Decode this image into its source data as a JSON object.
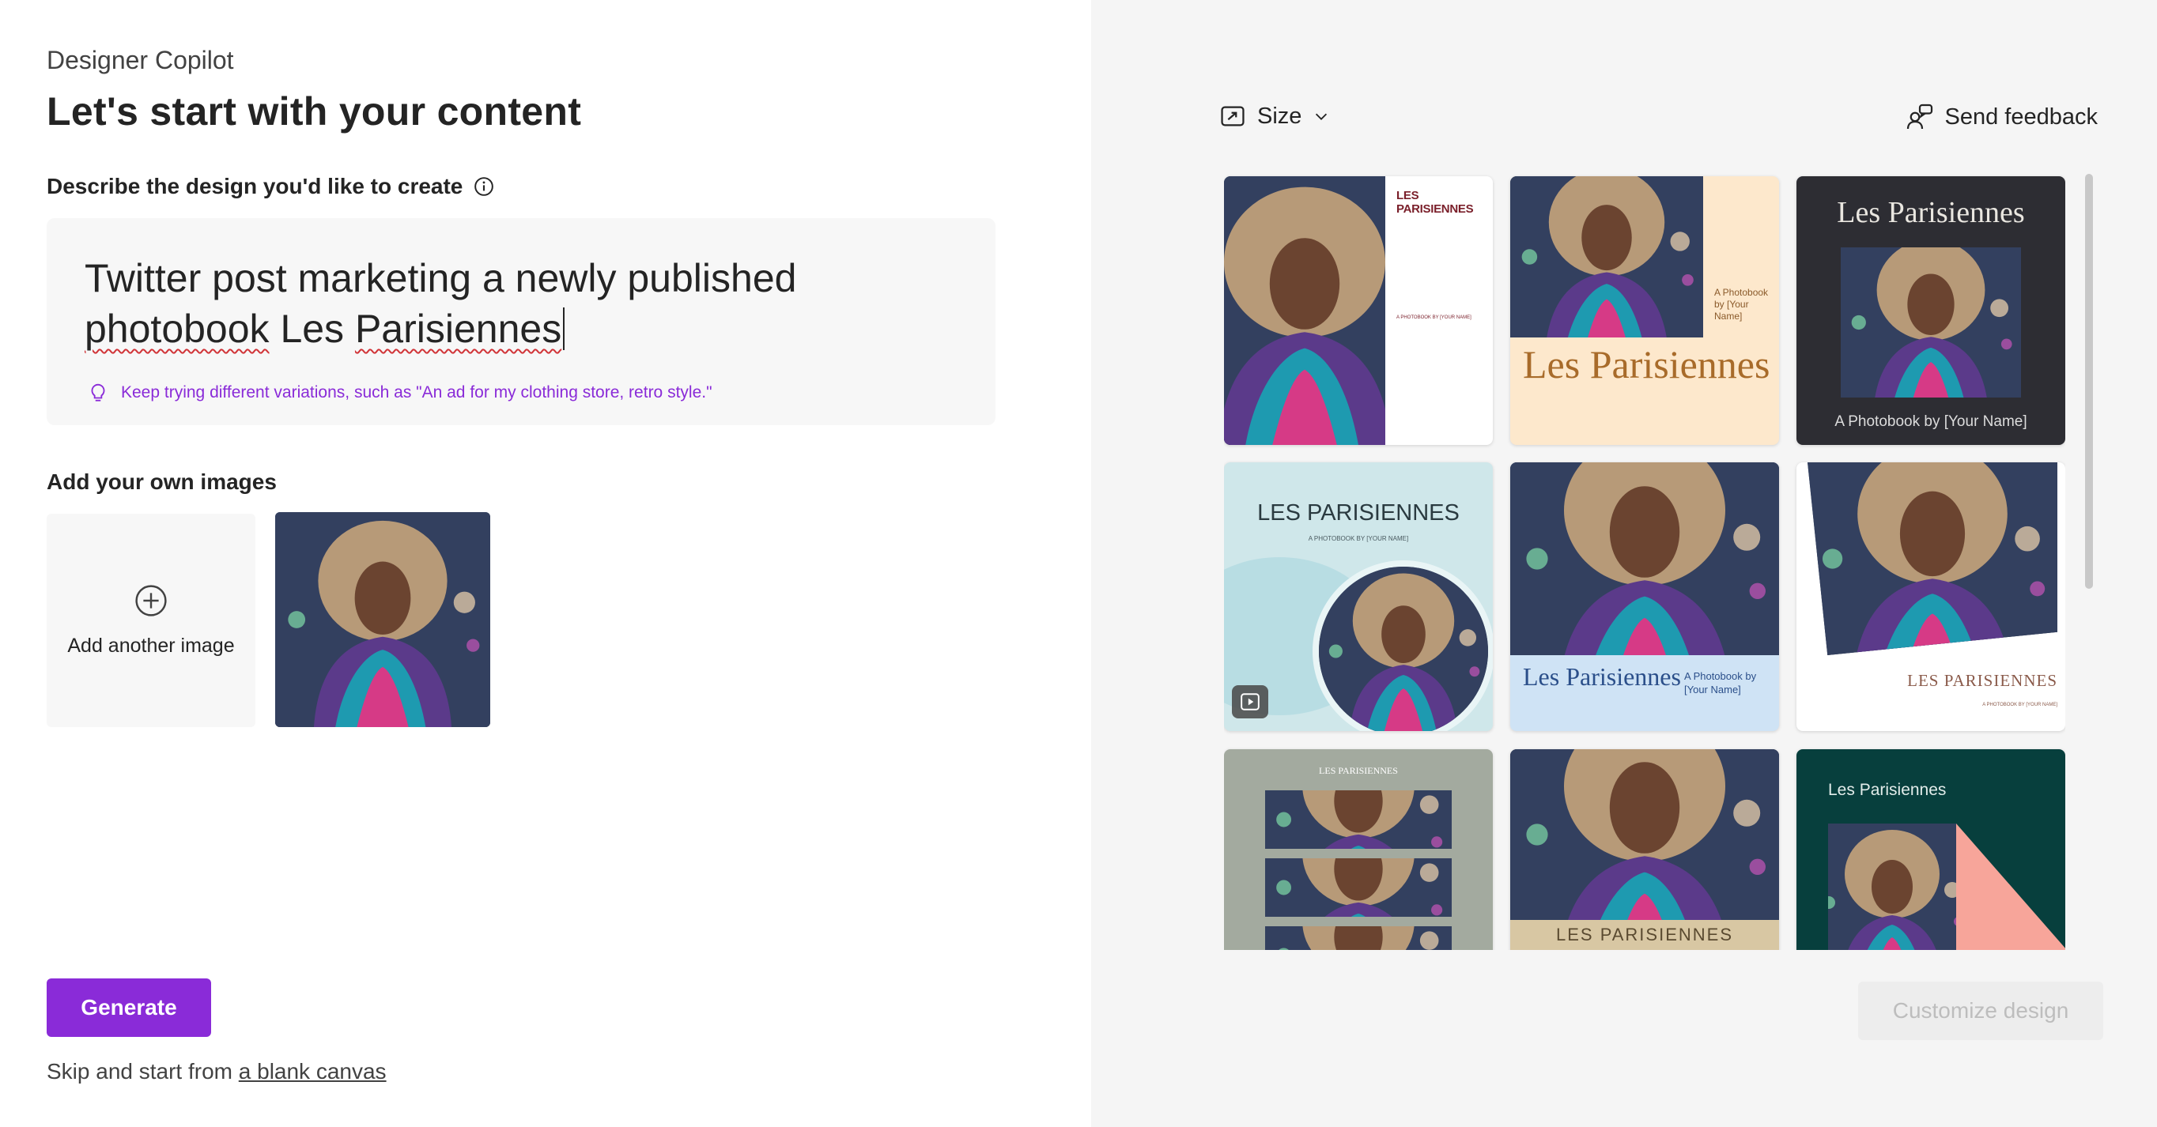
{
  "app": {
    "name": "Designer Copilot",
    "title": "Let's start with your content"
  },
  "prompt": {
    "label": "Describe the design you'd like to create",
    "text_part1": "Twitter post marketing a newly published ",
    "text_word1": "photobook",
    "text_part2": " Les ",
    "text_word2": "Parisiennes",
    "tip": "Keep trying different variations, such as \"An ad for my clothing store, retro style.\""
  },
  "images": {
    "label": "Add your own images",
    "add_label": "Add another image"
  },
  "actions": {
    "generate": "Generate",
    "skip_prefix": "Skip and start from ",
    "skip_link": "a blank canvas",
    "customize": "Customize design"
  },
  "toolbar": {
    "size": "Size",
    "feedback": "Send feedback"
  },
  "designs": {
    "d1_title": "LES PARISIENNES",
    "d1_sub": "A PHOTOBOOK BY [YOUR NAME]",
    "d2_sub": "A Photobook by [Your Name]",
    "d2_title": "Les Parisiennes",
    "d3_title": "Les Parisiennes",
    "d3_sub": "A Photobook by [Your Name]",
    "d4_title": "LES PARISIENNES",
    "d4_sub": "A PHOTOBOOK BY [YOUR NAME]",
    "d5_title": "Les Parisiennes",
    "d5_sub": "A Photobook by [Your Name]",
    "d6_title": "LES PARISIENNES",
    "d6_sub": "A PHOTOBOOK BY [YOUR NAME]",
    "d7_title": "LES PARISIENNES",
    "d8_title": "LES PARISIENNES",
    "d9_title": "Les Parisiennes"
  },
  "colors": {
    "accent": "#8a2bd8",
    "panel": "#f5f5f5",
    "d2_bg": "#fde8cc",
    "d3_bg": "#2d2d33",
    "d4_bg": "#cfe7ea",
    "d5_bg": "#cfe3f5",
    "d7_bg": "#a3aa9f",
    "d8_band": "#d8c7a3",
    "d9_bg": "#073f3d",
    "d9_triangle": "#f7a59a"
  },
  "icons": {
    "info": "info-icon",
    "tip": "lightbulb-icon",
    "add": "plus-circle-icon",
    "size": "resize-icon",
    "chevron": "chevron-down-icon",
    "feedback": "person-feedback-icon",
    "video": "video-play-icon"
  }
}
